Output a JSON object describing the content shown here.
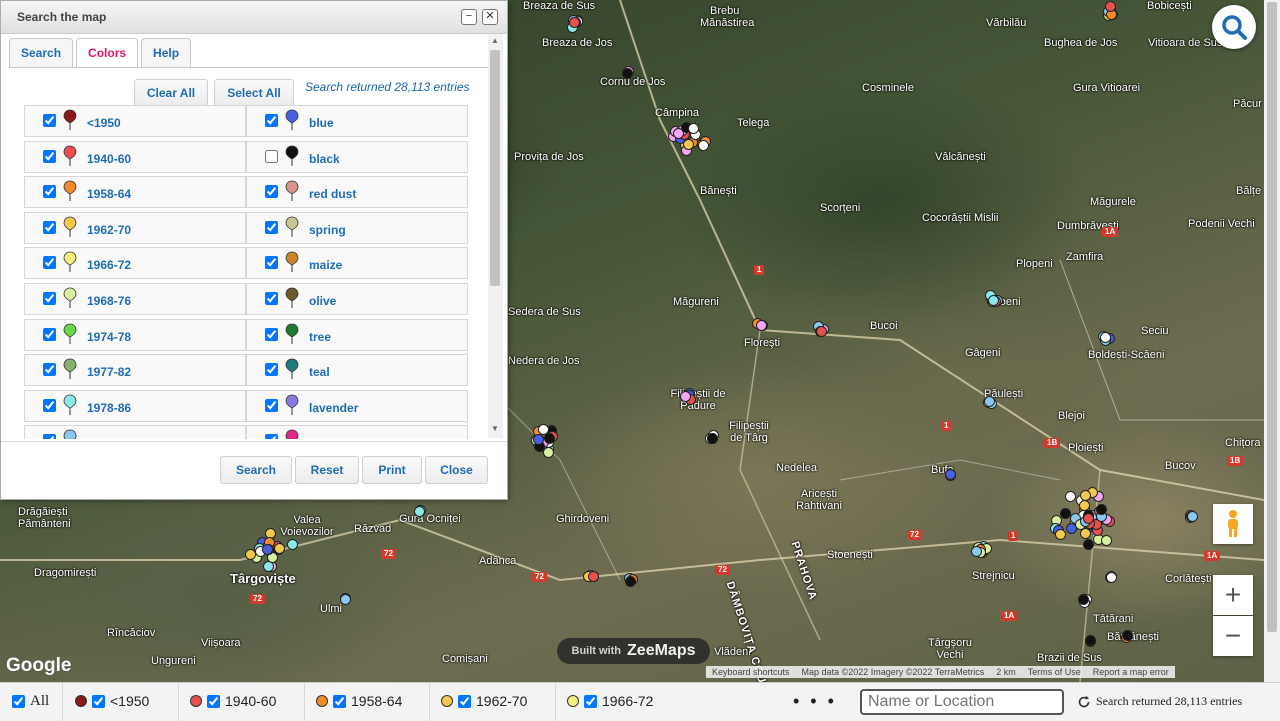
{
  "panel": {
    "title": "Search the map",
    "tabs": [
      {
        "label": "Search"
      },
      {
        "label": "Colors"
      },
      {
        "label": "Help"
      }
    ],
    "active_tab": "Colors",
    "clear_all": "Clear All",
    "select_all": "Select All",
    "result_text": "Search returned 28,113 entries",
    "colors": [
      {
        "label": "<1950",
        "checked": true,
        "color": "#8b1a1a"
      },
      {
        "label": "blue",
        "checked": true,
        "color": "#4a5ee0"
      },
      {
        "label": "1940-60",
        "checked": true,
        "color": "#e85050"
      },
      {
        "label": "black",
        "checked": false,
        "color": "#111111"
      },
      {
        "label": "1958-64",
        "checked": true,
        "color": "#f08a2a"
      },
      {
        "label": "red dust",
        "checked": true,
        "color": "#d8968a"
      },
      {
        "label": "1962-70",
        "checked": true,
        "color": "#f2c94c"
      },
      {
        "label": "spring",
        "checked": true,
        "color": "#c8c690"
      },
      {
        "label": "1966-72",
        "checked": true,
        "color": "#f6ef80"
      },
      {
        "label": "maize",
        "checked": true,
        "color": "#c8852a"
      },
      {
        "label": "1968-76",
        "checked": true,
        "color": "#d8f0a0"
      },
      {
        "label": "olive",
        "checked": true,
        "color": "#6b5a2a"
      },
      {
        "label": "1974-78",
        "checked": true,
        "color": "#6ad84a"
      },
      {
        "label": "tree",
        "checked": true,
        "color": "#1e7a2e"
      },
      {
        "label": "1977-82",
        "checked": true,
        "color": "#8ab070"
      },
      {
        "label": "teal",
        "checked": true,
        "color": "#1e7a7a"
      },
      {
        "label": "1978-86",
        "checked": true,
        "color": "#8ae8e8"
      },
      {
        "label": "lavender",
        "checked": true,
        "color": "#8a7ae0"
      }
    ],
    "buttons": {
      "search": "Search",
      "reset": "Reset",
      "print": "Print",
      "close": "Close"
    }
  },
  "map": {
    "places": [
      {
        "name": "Breaza de Sus"
      },
      {
        "name": "Breaza de Jos"
      },
      {
        "name": "Brebu"
      },
      {
        "name": "Mănăstirea"
      },
      {
        "name": "Vărbilău"
      },
      {
        "name": "Bobicești"
      },
      {
        "name": "Bughea de Jos"
      },
      {
        "name": "Vitioara de Sus"
      },
      {
        "name": "Cornu de Jos"
      },
      {
        "name": "Cosminele"
      },
      {
        "name": "Gura Vitioarei"
      },
      {
        "name": "Păcur"
      },
      {
        "name": "Câmpina"
      },
      {
        "name": "Telega"
      },
      {
        "name": "Provița de Jos"
      },
      {
        "name": "Vâlcănești"
      },
      {
        "name": "Bănești"
      },
      {
        "name": "Bălțe"
      },
      {
        "name": "Scorțeni"
      },
      {
        "name": "Cocorăștii Mislii"
      },
      {
        "name": "Măgurele"
      },
      {
        "name": "Dumbrăvești"
      },
      {
        "name": "Podenii Vechi"
      },
      {
        "name": "Plopeni"
      },
      {
        "name": "Zamfira"
      },
      {
        "name": "Măgureni"
      },
      {
        "name": "Seciu"
      },
      {
        "name": "Floreşti"
      },
      {
        "name": "Bucov"
      },
      {
        "name": "Gâgeni"
      },
      {
        "name": "Boldești-Scăeni"
      },
      {
        "name": "Păulești"
      },
      {
        "name": "Filipeștii de Pădure"
      },
      {
        "name": "Filipeștii de Târg"
      },
      {
        "name": "Blejoi"
      },
      {
        "name": "Ploiești"
      },
      {
        "name": "Chițora"
      },
      {
        "name": "Nedelea"
      },
      {
        "name": "Bucov"
      },
      {
        "name": "Aricești Rahtivani"
      },
      {
        "name": "Bărcănești"
      },
      {
        "name": "Drăgăiești Pământeni"
      },
      {
        "name": "Valea Voievozilor"
      },
      {
        "name": "Răzvad"
      },
      {
        "name": "Gura Ocniței"
      },
      {
        "name": "Ghirdoveni"
      },
      {
        "name": "Stoenești"
      },
      {
        "name": "Dragomirești"
      },
      {
        "name": "Târgoviște"
      },
      {
        "name": "Adânca"
      },
      {
        "name": "Strejnicu"
      },
      {
        "name": "Corlătești"
      },
      {
        "name": "Ulmi"
      },
      {
        "name": "Rîncăciov"
      },
      {
        "name": "Viișoara"
      },
      {
        "name": "Tătărani"
      },
      {
        "name": "Bărcănești"
      },
      {
        "name": "Târgșoru Vechi"
      },
      {
        "name": "Ungureni"
      },
      {
        "name": "Comișani"
      },
      {
        "name": "Vlădeni"
      },
      {
        "name": "Brazii de Sus"
      },
      {
        "name": "Florești"
      },
      {
        "name": "Bucoi"
      },
      {
        "name": "Ploiești"
      },
      {
        "name": "Bufa"
      },
      {
        "name": "Sedera de Sus"
      },
      {
        "name": "Nedera de Jos"
      },
      {
        "name": "Ploeni"
      }
    ],
    "county_label": "DÂMBOVIȚA COUNTY",
    "county_label_2": "PRAHOVA",
    "google_label": "Google",
    "zeemaps_small": "Built with",
    "zeemaps_big": "ZeeMaps",
    "attribution": [
      "Keyboard shortcuts",
      "Map data ©2022 Imagery ©2022 TerraMetrics",
      "2 km",
      "Terms of Use",
      "Report a map error"
    ]
  },
  "bottom_bar": {
    "all_label": "All",
    "legend": [
      {
        "label": "<1950",
        "color": "#8b1a1a"
      },
      {
        "label": "1940-60",
        "color": "#e85050"
      },
      {
        "label": "1958-64",
        "color": "#f08a2a"
      },
      {
        "label": "1962-70",
        "color": "#f2c94c"
      },
      {
        "label": "1966-72",
        "color": "#f6ef80"
      }
    ],
    "more": "• • •",
    "location_placeholder": "Name or Location",
    "result_text": "Search returned 28,113 entries"
  }
}
